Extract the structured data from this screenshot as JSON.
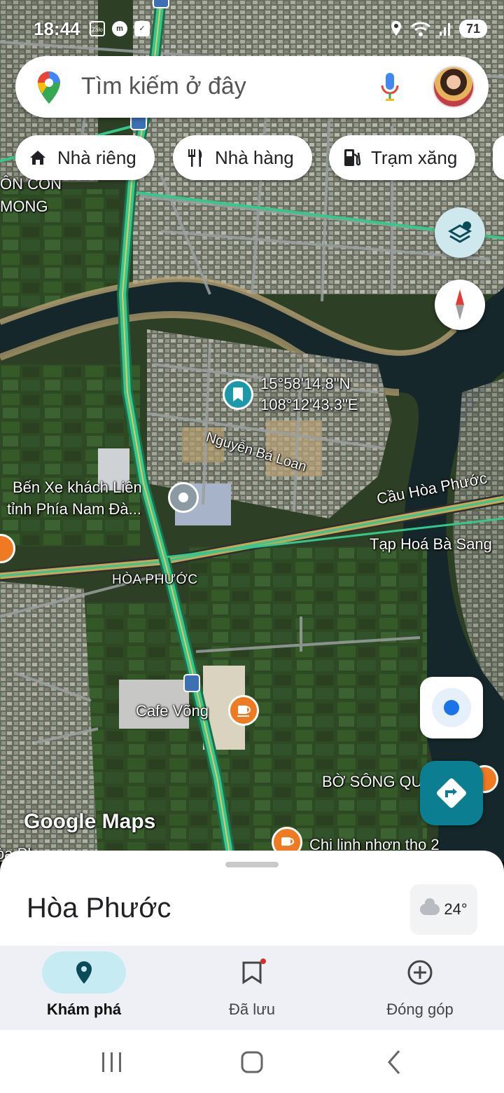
{
  "status_bar": {
    "time": "18:44",
    "notification_icons": [
      "zalo-icon",
      "messenger-icon",
      "checkbox-icon"
    ],
    "status_icons": [
      "location-icon",
      "wifi-icon",
      "signal-icon"
    ],
    "battery": "71"
  },
  "search": {
    "placeholder": "Tìm kiếm ở đây",
    "mic_icon": "mic-icon",
    "avatar_icon": "profile-avatar"
  },
  "chips": [
    {
      "label": "Nhà riêng",
      "icon": "home-icon"
    },
    {
      "label": "Nhà hàng",
      "icon": "restaurant-icon"
    },
    {
      "label": "Trạm xăng",
      "icon": "gas-station-icon"
    }
  ],
  "map": {
    "labels": {
      "con_mong_1": "ÔN CÔN",
      "con_mong_2": "MONG",
      "coord_lat": "15°58'14.8\"N",
      "coord_lng": "108°12'43.3\"E",
      "street": "Nguyễn Bá Loan",
      "bus_station_1": "Bến Xe khách Liên",
      "bus_station_2": "tỉnh Phía Nam Đà...",
      "bridge": "Cầu Hòa Phước",
      "shop": "Tạp Hoá Bà Sang",
      "area": "HÒA PHƯỚC",
      "cafe": "Cafe Võng",
      "riverbank": "BỜ SÔNG QU",
      "chi_linh": "Chi linh nhơn tho 2",
      "edge": "òa Ph",
      "watermark": "Google Maps"
    },
    "colors": {
      "highway": "#34c98a",
      "pin_teal": "#1a9aa8",
      "poi_orange": "#f07a22",
      "directions_fab": "#0b7e91"
    }
  },
  "sheet": {
    "place_name": "Hòa Phước",
    "weather_temp": "24°"
  },
  "bottom_nav": [
    {
      "label": "Khám phá",
      "icon": "explore-pin-icon",
      "active": true
    },
    {
      "label": "Đã lưu",
      "icon": "bookmark-icon",
      "active": false
    },
    {
      "label": "Đóng góp",
      "icon": "add-circle-icon",
      "active": false
    }
  ]
}
